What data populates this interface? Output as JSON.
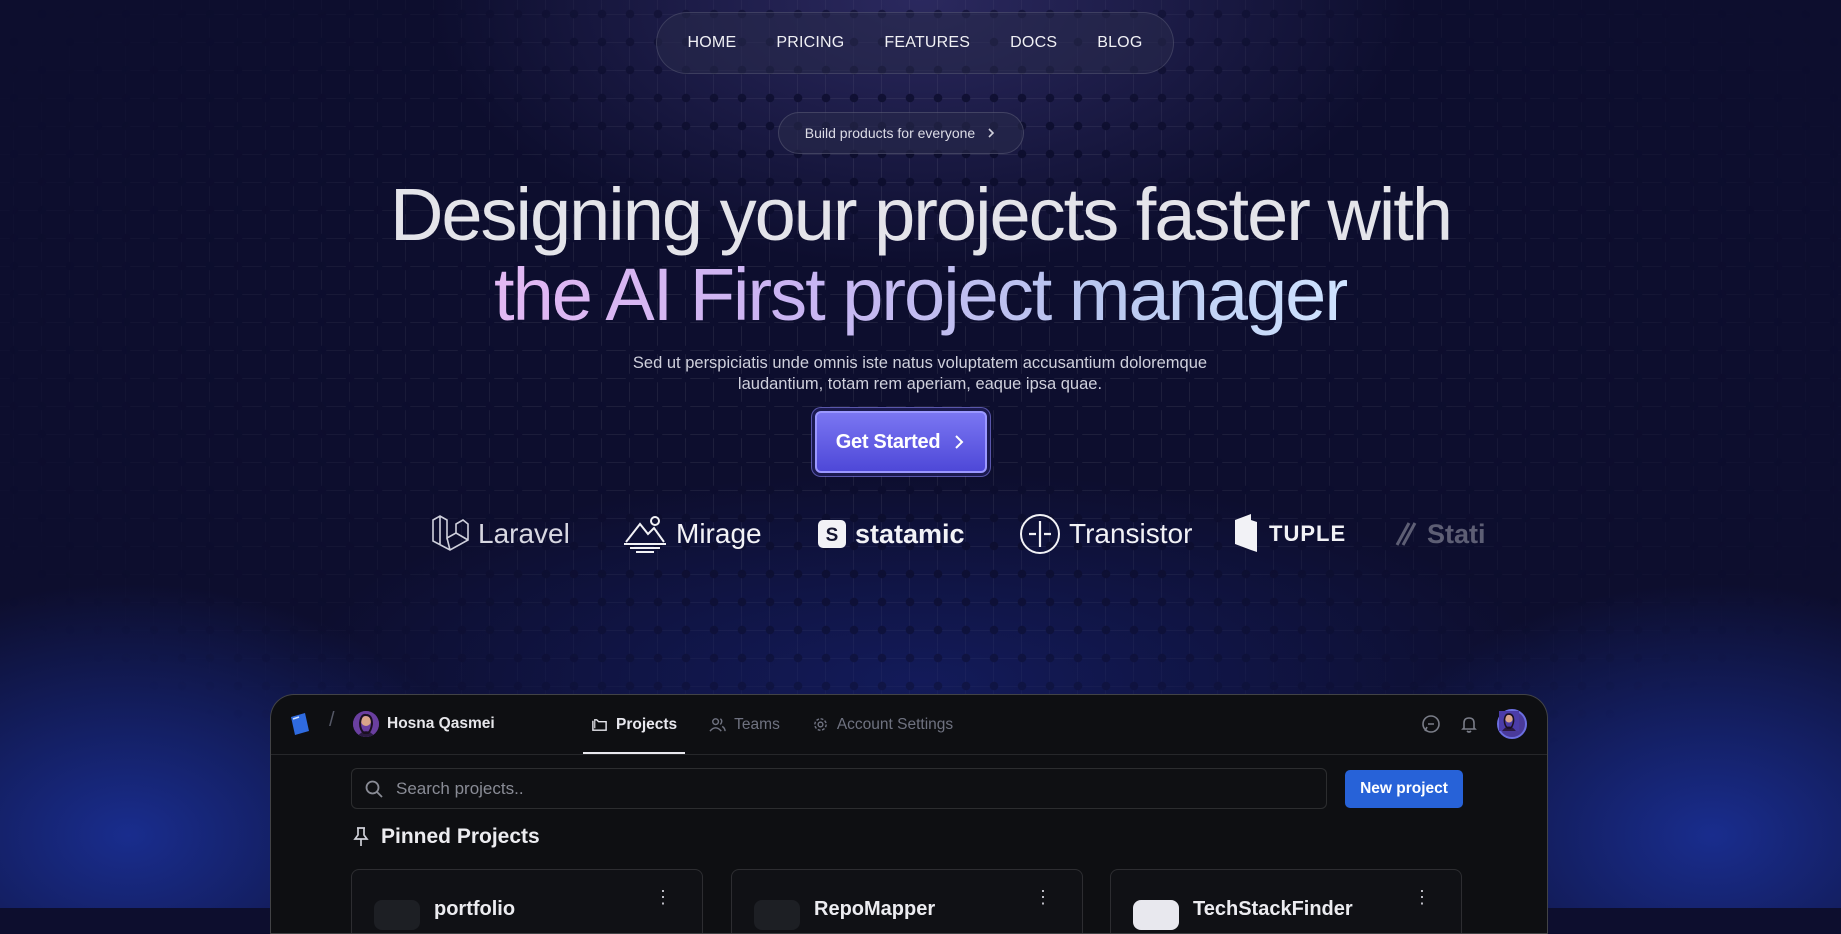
{
  "nav": {
    "items": [
      {
        "label": "HOME"
      },
      {
        "label": "PRICING"
      },
      {
        "label": "FEATURES"
      },
      {
        "label": "DOCS"
      },
      {
        "label": "BLOG"
      }
    ]
  },
  "hero": {
    "pill_label": "Build products for everyone",
    "title_line1": "Designing your projects faster with",
    "title_line2": "the AI First project manager",
    "subtitle": "Sed ut perspiciatis unde omnis iste natus voluptatem accusantium doloremque laudantium, totam rem aperiam, eaque ipsa quae.",
    "cta_label": "Get Started",
    "accent": "#5b55e0"
  },
  "logos": [
    {
      "name": "Laravel"
    },
    {
      "name": "Mirage"
    },
    {
      "name": "statamic"
    },
    {
      "name": "Transistor"
    },
    {
      "name": "TUPLE"
    },
    {
      "name": "Stati"
    }
  ],
  "app": {
    "user_name": "Hosna Qasmei",
    "tabs": [
      {
        "label": "Projects",
        "icon": "folder-icon",
        "active": true
      },
      {
        "label": "Teams",
        "icon": "users-icon",
        "active": false
      },
      {
        "label": "Account Settings",
        "icon": "gear-icon",
        "active": false
      }
    ],
    "search_placeholder": "Search projects..",
    "new_project_label": "New project",
    "pinned_title": "Pinned Projects",
    "cards": [
      {
        "name": "portfolio"
      },
      {
        "name": "RepoMapper"
      },
      {
        "name": "TechStackFinder"
      }
    ],
    "primary_button_color": "#2762d8"
  }
}
